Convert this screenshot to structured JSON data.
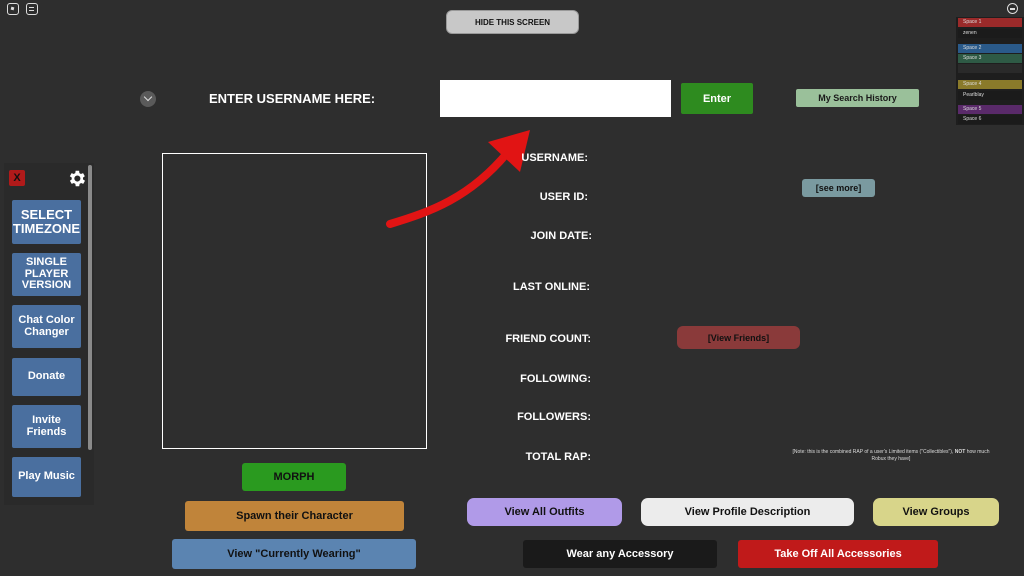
{
  "hide_button": "HIDE THIS SCREEN",
  "search": {
    "prompt": "ENTER USERNAME HERE:",
    "input_value": "",
    "enter_label": "Enter",
    "history_label": "My Search History"
  },
  "fields": {
    "username": "USERNAME:",
    "user_id": "USER ID:",
    "join_date": "JOIN DATE:",
    "last_online": "LAST ONLINE:",
    "friend_count": "FRIEND COUNT:",
    "following": "FOLLOWING:",
    "followers": "FOLLOWERS:",
    "total_rap": "TOTAL RAP:"
  },
  "see_more": "[see more]",
  "view_friends": "[View Friends]",
  "rap_note_pre": "[Note: this is the combined RAP of a user's Limited items (\"Collectibles\"), ",
  "rap_note_bold": "NOT",
  "rap_note_post": " how much Robux they have]",
  "sidebar": {
    "close_label": "X",
    "items": [
      "SELECT TIMEZONE",
      "SINGLE PLAYER VERSION",
      "Chat Color Changer",
      "Donate",
      "Invite Friends",
      "Play Music"
    ]
  },
  "buttons": {
    "morph": "MORPH",
    "spawn": "Spawn their Character",
    "currently_wearing": "View \"Currently Wearing\"",
    "outfits": "View All Outfits",
    "profile_desc": "View Profile Description",
    "groups": "View Groups",
    "wear_accessory": "Wear any Accessory",
    "take_off": "Take Off All Accessories"
  },
  "spaces": [
    {
      "name": "Space 1",
      "color": "#9b2a2a"
    },
    {
      "name": "zenen",
      "color": "#1b1b1b"
    },
    {
      "name": "Space 2",
      "color": "#2a5a8a"
    },
    {
      "name": "Space 3",
      "color": "#2e5a45"
    },
    {
      "name": "",
      "color": "#2a2a2a"
    },
    {
      "name": "Space 4",
      "color": "#8a7a2a"
    },
    {
      "name": "Pearlblay",
      "color": "#1b1b1b"
    },
    {
      "name": "Space 5",
      "color": "#5a2a6a"
    },
    {
      "name": "Space 6",
      "color": "#1b1b1b"
    }
  ],
  "colors": {
    "background": "#2e2e2e",
    "enter": "#2e8b1f",
    "morph": "#2a9a1f",
    "spawn": "#c0843a",
    "wearing": "#5b84b1",
    "outfits": "#b09ae8",
    "profile": "#ececec",
    "groups": "#d8d58a",
    "wear": "#1a1a1a",
    "takeoff": "#c01a1a",
    "friends": "#8a3a3a",
    "history": "#9ac09a",
    "seemore": "#7a9aa0"
  }
}
